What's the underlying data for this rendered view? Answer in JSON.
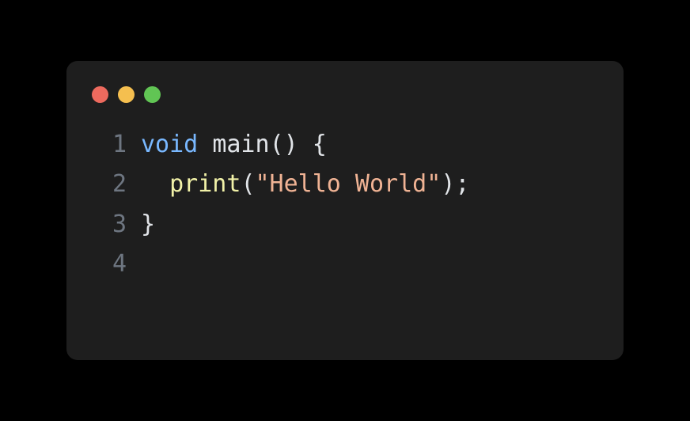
{
  "traffic_lights": {
    "close_color": "#ed6a5e",
    "minimize_color": "#f5bf4f",
    "maximize_color": "#61c554"
  },
  "colors": {
    "window_bg": "#1e1e1e",
    "page_bg": "#000000",
    "line_number": "#6e7681",
    "keyword": "#79b8ff",
    "function_name": "#e1e4e8",
    "punctuation": "#e1e4e8",
    "call": "#f2f2a8",
    "string": "#f0b394"
  },
  "code": {
    "lines": [
      {
        "n": "1",
        "tokens": [
          {
            "cls": "tok-kw",
            "t": "void"
          },
          {
            "cls": "tok-plain",
            "t": " "
          },
          {
            "cls": "tok-fn",
            "t": "main"
          },
          {
            "cls": "tok-punct",
            "t": "()"
          },
          {
            "cls": "tok-plain",
            "t": " "
          },
          {
            "cls": "tok-punct",
            "t": "{"
          }
        ]
      },
      {
        "n": "2",
        "tokens": [
          {
            "cls": "tok-plain",
            "t": "  "
          },
          {
            "cls": "tok-call",
            "t": "print"
          },
          {
            "cls": "tok-punct",
            "t": "("
          },
          {
            "cls": "tok-str",
            "t": "\"Hello World\""
          },
          {
            "cls": "tok-punct",
            "t": ");"
          }
        ]
      },
      {
        "n": "3",
        "tokens": [
          {
            "cls": "tok-punct",
            "t": "}"
          }
        ]
      },
      {
        "n": "4",
        "tokens": []
      }
    ]
  }
}
